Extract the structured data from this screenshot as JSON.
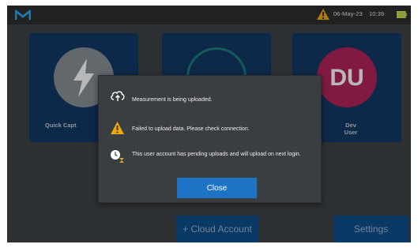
{
  "status_bar": {
    "date": "06-May-23",
    "time": "10:39",
    "icons": [
      "brand-logo-icon",
      "warning-icon",
      "battery-icon"
    ]
  },
  "tiles": [
    {
      "label": "Quick Capt",
      "icon": "lightning-icon"
    },
    {
      "label": "",
      "icon": "circle-icon"
    },
    {
      "initials": "DU",
      "label_line1": "Dev",
      "label_line2": "User"
    }
  ],
  "bottom_buttons": {
    "cloud_account": "+ Cloud Account",
    "settings": "Settings"
  },
  "dialog": {
    "messages": [
      {
        "icon": "cloud-upload-icon",
        "text": "Measurement is being uploaded."
      },
      {
        "icon": "warning-icon",
        "text": "Failed to upload data. Please check connection."
      },
      {
        "icon": "pending-upload-icon",
        "text": "This user account has pending uploads and will upload on next login."
      }
    ],
    "close_label": "Close"
  },
  "colors": {
    "tile_bg": "#123a66",
    "dev_user_accent": "#b3245a",
    "warning": "#f0a80a",
    "close_button": "#1e74c4",
    "battery": "#c8d84a"
  }
}
